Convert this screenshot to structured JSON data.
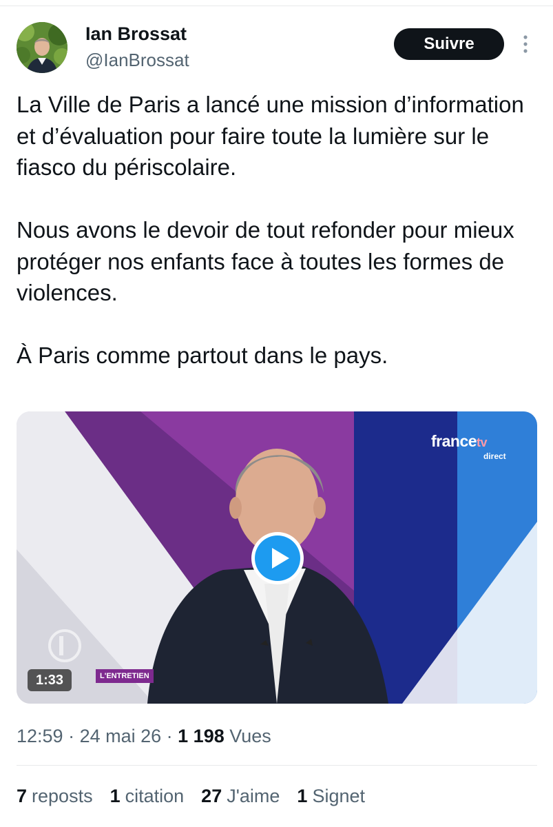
{
  "author": {
    "display_name": "Ian Brossat",
    "handle": "@IanBrossat"
  },
  "header": {
    "follow_label": "Suivre"
  },
  "tweet": {
    "paragraphs": [
      "La Ville de Paris a lancé une mission d’information et d’évaluation pour faire toute la lumière sur le fiasco du périscolaire.",
      "Nous avons le devoir de tout refonder pour mieux protéger nos enfants face à toutes les formes de violences.",
      "À Paris comme partout dans le pays."
    ]
  },
  "media": {
    "channel_brand": "france",
    "channel_brand_suffix": "tv",
    "channel_live": "direct",
    "duration": "1:33",
    "segment_tag": "L'ENTRETIEN",
    "play_icon": "play-icon"
  },
  "meta": {
    "time": "12:59",
    "separator": " · ",
    "date": "24 mai 26",
    "views_count": "1 198",
    "views_label": "Vues"
  },
  "stats": [
    {
      "count": "7",
      "label": "reposts"
    },
    {
      "count": "1",
      "label": "citation"
    },
    {
      "count": "27",
      "label": "J'aime"
    },
    {
      "count": "1",
      "label": "Signet"
    }
  ],
  "colors": {
    "text_primary": "#0f1419",
    "text_secondary": "#536471",
    "play_blue": "#1d9bf0",
    "divider": "#e7e9ea"
  }
}
